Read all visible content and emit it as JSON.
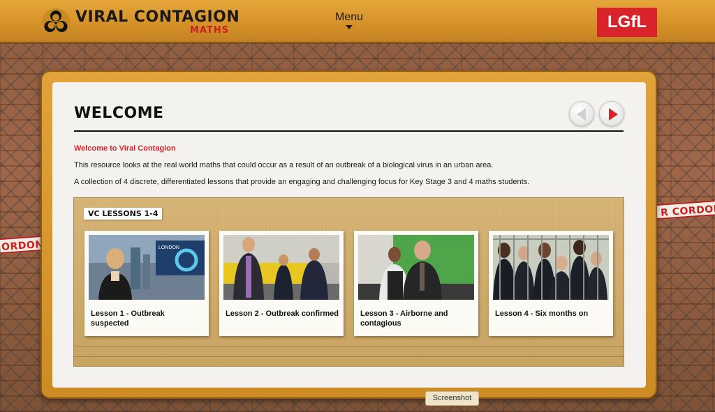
{
  "header": {
    "logo_title": "VIRAL CONTAGION",
    "logo_subtitle": "MATHS",
    "menu_label": "Menu",
    "partner_logo": "LGfL"
  },
  "tapes": {
    "left": "ORDON",
    "right": "R CORDON"
  },
  "main": {
    "title": "WELCOME",
    "intro_heading": "Welcome to Viral Contagion",
    "paragraphs": [
      "This resource looks at the real world maths that could occur as a result of an outbreak of a biological virus in an urban area.",
      "A collection of 4 discrete, differentiated lessons that provide an engaging and challenging focus for Key Stage 3 and 4 maths students."
    ],
    "nav": {
      "prev_icon": "triangle-left-icon",
      "next_icon": "triangle-right-icon"
    }
  },
  "lessons": {
    "label": "VC LESSONS 1-4",
    "items": [
      {
        "title": "Lesson 1 - Outbreak suspected",
        "thumb_caption": "LONDON"
      },
      {
        "title": "Lesson 2 - Outbreak confirmed"
      },
      {
        "title": "Lesson 3 - Airborne and contagious"
      },
      {
        "title": "Lesson 4 - Six months on"
      }
    ]
  },
  "tooltip": "Screenshot",
  "colors": {
    "brand_red": "#d8232a",
    "header_orange": "#e6a63a",
    "board_tan": "#d7b577"
  }
}
